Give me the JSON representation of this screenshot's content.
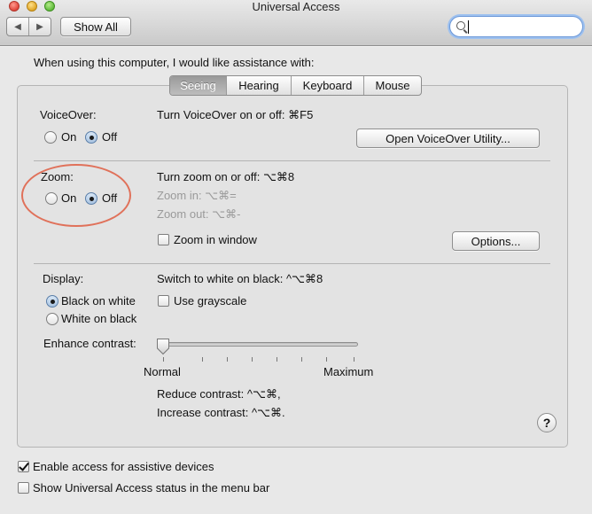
{
  "window": {
    "title": "Universal Access",
    "accent": "#e0715a"
  },
  "toolbar": {
    "back_icon": "chevron-left-icon",
    "forward_icon": "chevron-right-icon",
    "show_all": "Show All",
    "search_value": "",
    "search_icon": "search-icon"
  },
  "intro": "When using this computer, I would like assistance with:",
  "tabs": [
    {
      "label": "Seeing",
      "active": true
    },
    {
      "label": "Hearing",
      "active": false
    },
    {
      "label": "Keyboard",
      "active": false
    },
    {
      "label": "Mouse",
      "active": false
    }
  ],
  "voiceover": {
    "label": "VoiceOver:",
    "on": "On",
    "off": "Off",
    "selected": "Off",
    "shortcut": "Turn VoiceOver on or off: ⌘F5",
    "utility_button": "Open VoiceOver Utility..."
  },
  "zoom": {
    "label": "Zoom:",
    "on": "On",
    "off": "Off",
    "selected": "Off",
    "shortcut": "Turn zoom on or off: ⌥⌘8",
    "zoom_in": "Zoom in: ⌥⌘=",
    "zoom_out": "Zoom out: ⌥⌘-",
    "zoom_in_window": "Zoom in window",
    "zoom_in_window_checked": false,
    "options_button": "Options..."
  },
  "display": {
    "label": "Display:",
    "black_on_white": "Black on white",
    "white_on_black": "White on black",
    "selected": "Black on white",
    "shortcut": "Switch to white on black: ^⌥⌘8",
    "grayscale": "Use grayscale",
    "grayscale_checked": false,
    "contrast_label": "Enhance contrast:",
    "contrast_value": 0,
    "contrast_min": "Normal",
    "contrast_max": "Maximum",
    "reduce": "Reduce contrast: ^⌥⌘,",
    "increase": "Increase contrast: ^⌥⌘."
  },
  "help": "?",
  "footer": {
    "assistive": "Enable access for assistive devices",
    "assistive_checked": true,
    "status": "Show Universal Access status in the menu bar",
    "status_checked": false
  }
}
